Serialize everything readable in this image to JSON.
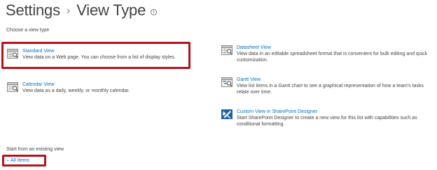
{
  "header": {
    "breadcrumb_root": "Settings",
    "separator": "›",
    "page_title": "View Type",
    "info_glyph": "i"
  },
  "choose_label": "Choose a view type",
  "views": {
    "standard": {
      "title": "Standard View",
      "description": "View data on a Web page. You can choose from a list of display styles.",
      "icon": "standard-view-icon"
    },
    "calendar": {
      "title": "Calendar View",
      "description": "View data as a daily, weekly, or monthly calendar.",
      "icon": "calendar-view-icon"
    },
    "datasheet": {
      "title": "Datasheet View",
      "description": "View data in an editable spreadsheet format that is convenient for bulk editing and quick customization.",
      "icon": "datasheet-view-icon"
    },
    "gantt": {
      "title": "Gantt View",
      "description": "View list items in a Gantt chart to see a graphical representation of how a team's tasks relate over time.",
      "icon": "gantt-view-icon"
    },
    "spd": {
      "title": "Custom View in SharePoint Designer",
      "description": "Start SharePoint Designer to create a new view for this list with capabilities such as conditional formatting.",
      "icon": "sharepoint-designer-icon"
    }
  },
  "existing_label": "Start from an existing view",
  "existing_views": {
    "all_items": "All Items",
    "bullet": "▪"
  },
  "colors": {
    "link": "#0072c6",
    "text": "#444444",
    "highlight": "#b5121b",
    "spd_icon_bg": "#1f5fa8"
  }
}
